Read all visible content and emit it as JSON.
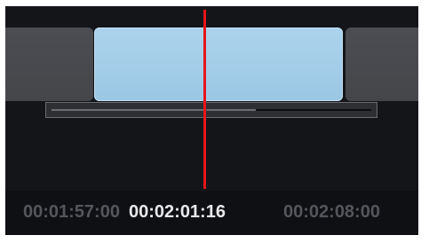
{
  "timeline": {
    "playback_progress": 0.64,
    "timecodes": {
      "start": "00:01:57:00",
      "current": "00:02:01:16",
      "end": "00:02:08:00"
    }
  },
  "colors": {
    "frame_background": "#141519",
    "clip_neutral": "#4c4d52",
    "clip_selected": "#acd3ec",
    "playhead": "#e8141a",
    "timecode_active": "#e8e8ea",
    "timecode_inactive": "#54565c"
  }
}
